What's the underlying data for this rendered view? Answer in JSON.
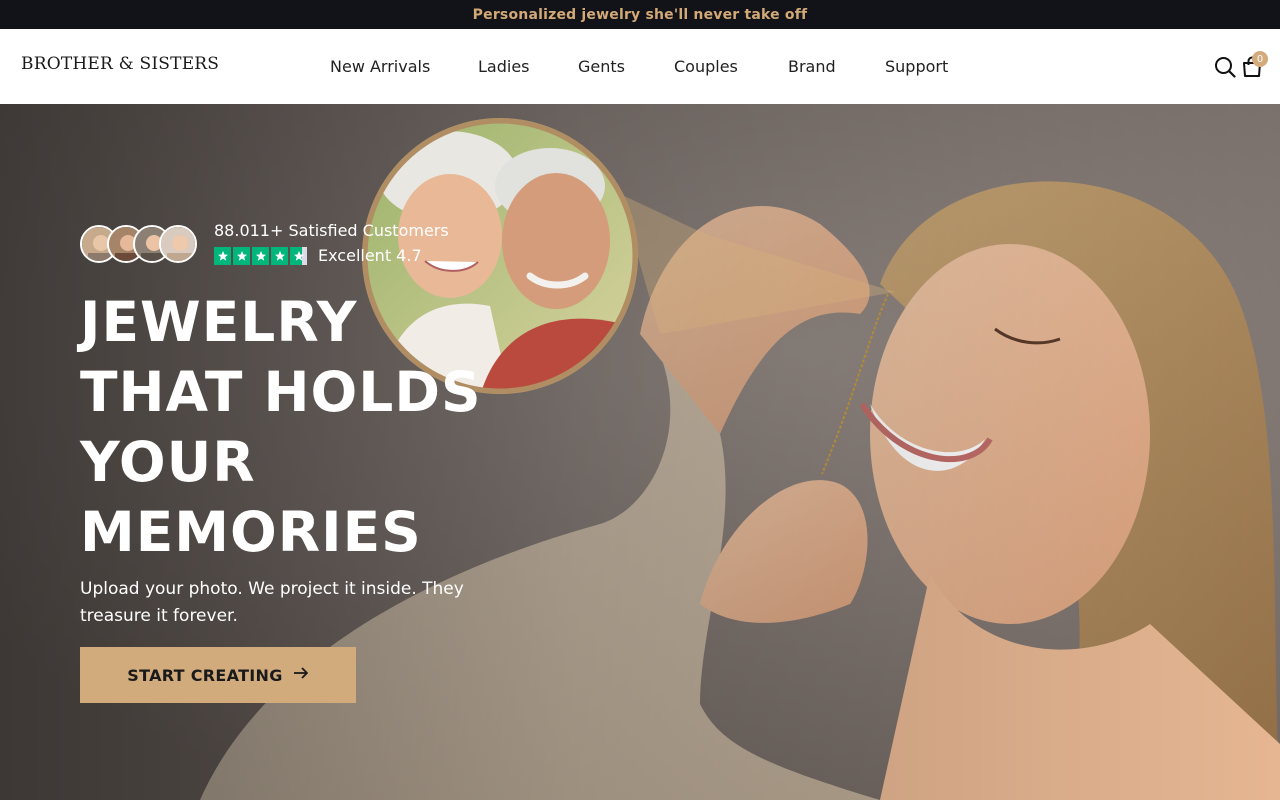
{
  "announcement": "Personalized jewelry she'll never take off",
  "header": {
    "logo": "BROTHER & SISTERS",
    "nav": [
      "New Arrivals",
      "Ladies",
      "Gents",
      "Couples",
      "Brand",
      "Support"
    ],
    "search_icon": "search-icon",
    "cart_icon": "shopping-bag-icon",
    "cart_count": "0"
  },
  "hero": {
    "social_proof": {
      "customers": "88.011+ Satisfied Customers",
      "rating_label": "Excellent 4.7",
      "rating_value": 4.7,
      "stars_max": 5
    },
    "headline": [
      "JEWELRY",
      "THAT HOLDS",
      "YOUR",
      "MEMORIES"
    ],
    "subtext": "Upload your photo. We project it inside. They treasure it forever.",
    "cta": "START CREATING",
    "cta_icon": "arrow-right-icon"
  },
  "colors": {
    "announcement_bg": "#121318",
    "announcement_text": "#d2a977",
    "accent": "#d2ab7d",
    "trustpilot_green": "#00b67a"
  }
}
